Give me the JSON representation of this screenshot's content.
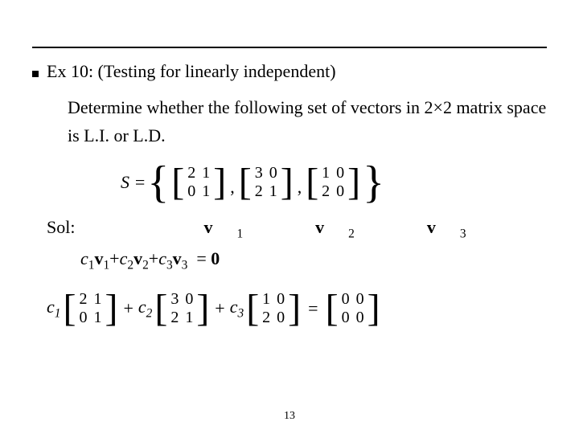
{
  "hr": true,
  "bullet_title": "Ex 10: (Testing for linearly independent)",
  "body": "Determine whether the following set of vectors in 2×2 matrix space  is L.I. or L.D.",
  "set_lhs": "S =",
  "set_open": "{",
  "set_close": "}",
  "set_sep": ",",
  "chart_data": {
    "type": "table",
    "matrices": [
      {
        "label": "v1",
        "rows": [
          [
            2,
            1
          ],
          [
            0,
            1
          ]
        ]
      },
      {
        "label": "v2",
        "rows": [
          [
            3,
            0
          ],
          [
            2,
            1
          ]
        ]
      },
      {
        "label": "v3",
        "rows": [
          [
            1,
            0
          ],
          [
            2,
            0
          ]
        ]
      }
    ],
    "zero": {
      "rows": [
        [
          0,
          0
        ],
        [
          0,
          0
        ]
      ]
    },
    "coeffs": [
      "c1",
      "c2",
      "c3"
    ]
  },
  "sol_label": "Sol:",
  "v1": "v",
  "v1s": "1",
  "v2": "v",
  "v2s": "2",
  "v3": "v",
  "v3s": "3",
  "eq_plain_pre_c1": "c",
  "eq_plain": "c₁v₁+c₂v₂+c₃v₃ = 0",
  "c1": "c",
  "c1s": "1",
  "c2": "c",
  "c2s": "2",
  "c3": "c",
  "c3s": "3",
  "zero": "0",
  "plus": "+",
  "eq": "=",
  "slidenum": "13"
}
